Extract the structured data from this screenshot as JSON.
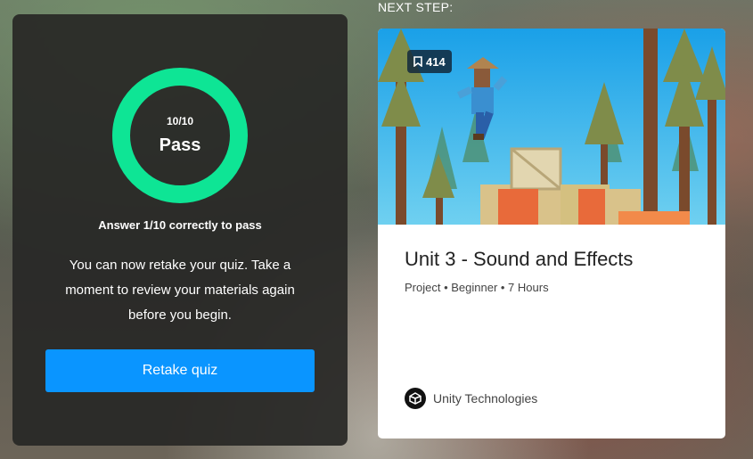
{
  "quiz": {
    "score": "10/10",
    "status": "Pass",
    "threshold": "Answer 1/10 correctly to pass",
    "message": "You can now retake your quiz. Take a moment to review your materials again before you begin.",
    "retake_label": "Retake quiz",
    "progress_fraction": 1.0,
    "ring_color": "#0ee595",
    "button_color": "#0a95ff"
  },
  "next": {
    "heading": "NEXT STEP:",
    "card": {
      "bookmark_count": "414",
      "title": "Unit 3 - Sound and Effects",
      "meta": "Project • Beginner • 7 Hours",
      "author": "Unity Technologies",
      "author_icon": "unity-logo-icon",
      "bookmark_icon": "bookmark-icon"
    }
  }
}
